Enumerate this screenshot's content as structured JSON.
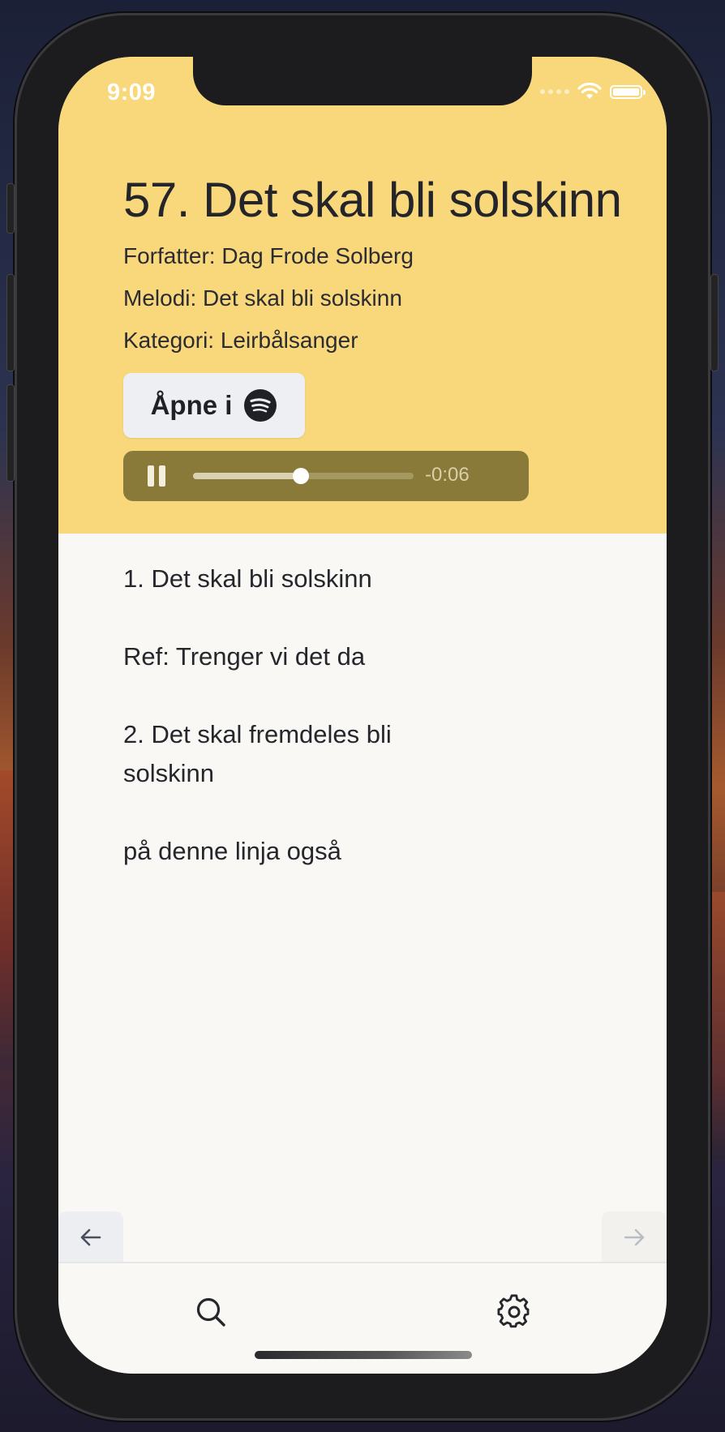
{
  "status_bar": {
    "time": "9:09"
  },
  "song": {
    "title": "57. Det skal bli solskinn",
    "author": "Forfatter: Dag Frode Solberg",
    "melody": "Melodi: Det skal bli solskinn",
    "category": "Kategori: Leirbålsanger"
  },
  "spotify_button": {
    "label": "Åpne i",
    "icon": "spotify-icon"
  },
  "player": {
    "state": "playing",
    "progress": 0.49,
    "time_remaining": "-0:06"
  },
  "lyrics": [
    "1. Det skal bli solskinn",
    "Ref: Trenger vi det da",
    "2. Det skal fremdeles bli\nsolskinn",
    "på denne linja også"
  ],
  "navigation": {
    "prev_icon": "arrow-left-icon",
    "next_icon": "arrow-right-icon"
  },
  "tabbar": {
    "search_icon": "search-icon",
    "settings_icon": "gear-icon"
  },
  "colors": {
    "header_bg": "#f9d77b",
    "player_bg": "#8a7a3a",
    "content_bg": "#faf8f4"
  }
}
